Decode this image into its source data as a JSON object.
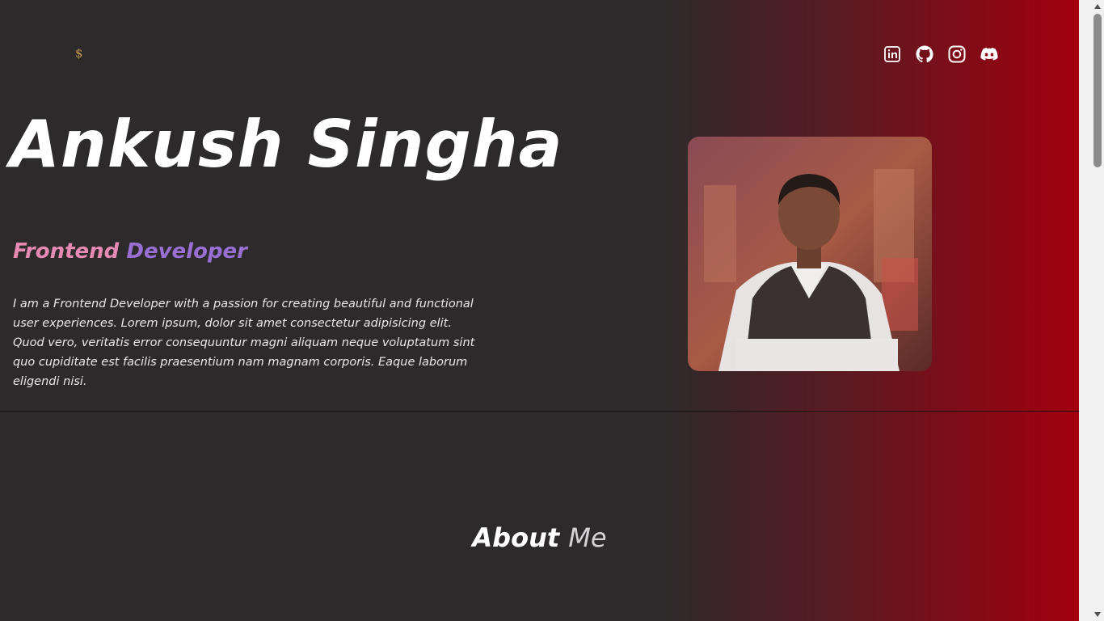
{
  "header": {
    "logo_text": "$",
    "socials": [
      {
        "name": "linkedin-icon"
      },
      {
        "name": "github-icon"
      },
      {
        "name": "instagram-icon"
      },
      {
        "name": "discord-icon"
      }
    ]
  },
  "hero": {
    "name": "Ankush Singha",
    "role_word1": "Frontend",
    "role_word2": "Developer",
    "bio": "I am a Frontend Developer with a passion for creating beautiful and functional user experiences. Lorem ipsum, dolor sit amet consectetur adipisicing elit. Quod vero, veritatis error consequuntur magni aliquam neque voluptatum sint quo cupiditate est facilis praesentium nam magnam corporis. Eaque laborum eligendi nisi."
  },
  "about": {
    "title_word1": "About",
    "title_word2": "Me"
  },
  "colors": {
    "background": "#2c2a2b",
    "gradient_end": "#a3000e",
    "role_pink": "#e68ab4",
    "role_purple": "#9a6fd4",
    "logo_gold": "#c59a4a"
  }
}
